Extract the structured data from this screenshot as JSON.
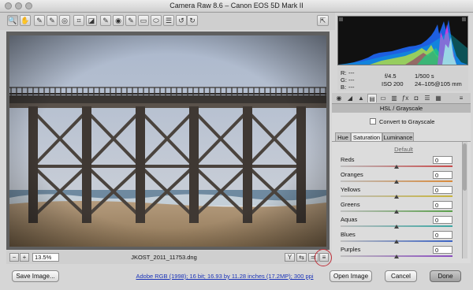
{
  "window": {
    "title": "Camera Raw 8.6  –  Canon EOS 5D Mark II"
  },
  "toolbar": {
    "tools": [
      {
        "name": "zoom-tool-icon",
        "glyph": "🔍"
      },
      {
        "name": "hand-tool-icon",
        "glyph": "✋"
      },
      {
        "name": "white-balance-tool-icon",
        "glyph": "✎"
      },
      {
        "name": "color-sampler-tool-icon",
        "glyph": "✎"
      },
      {
        "name": "target-adjustment-tool-icon",
        "glyph": "◎"
      },
      {
        "name": "crop-tool-icon",
        "glyph": "⌗"
      },
      {
        "name": "straighten-tool-icon",
        "glyph": "◪"
      },
      {
        "name": "spot-removal-tool-icon",
        "glyph": "✎"
      },
      {
        "name": "red-eye-tool-icon",
        "glyph": "◉"
      },
      {
        "name": "adjustment-brush-icon",
        "glyph": "✎"
      },
      {
        "name": "graduated-filter-icon",
        "glyph": "▭"
      },
      {
        "name": "radial-filter-icon",
        "glyph": "⬭"
      },
      {
        "name": "preferences-icon",
        "glyph": "☰"
      },
      {
        "name": "rotate-ccw-icon",
        "glyph": "↺"
      },
      {
        "name": "rotate-cw-icon",
        "glyph": "↻"
      }
    ],
    "fullscreen_icon": "⇱"
  },
  "statusbar": {
    "zoom": "13.5%",
    "filename": "JKOST_2011_11753.dng"
  },
  "info": {
    "r_label": "R:",
    "g_label": "G:",
    "b_label": "B:",
    "r": "---",
    "g": "---",
    "b": "---",
    "aperture": "f/4.5",
    "shutter": "1/500 s",
    "iso": "ISO 200",
    "lens": "24–105@105 mm"
  },
  "panel": {
    "title": "HSL / Grayscale",
    "convert_label": "Convert to Grayscale",
    "convert_checked": false,
    "subtabs": [
      "Hue",
      "Saturation",
      "Luminance"
    ],
    "active_subtab": "Saturation",
    "default_label": "Default",
    "sliders": [
      {
        "label": "Reds",
        "value": "0",
        "color": "#c84a4a"
      },
      {
        "label": "Oranges",
        "value": "0",
        "color": "#d98a3a"
      },
      {
        "label": "Yellows",
        "value": "0",
        "color": "#c9b43a"
      },
      {
        "label": "Greens",
        "value": "0",
        "color": "#5aa04a"
      },
      {
        "label": "Aquas",
        "value": "0",
        "color": "#3ba7a3"
      },
      {
        "label": "Blues",
        "value": "0",
        "color": "#3b63c4"
      },
      {
        "label": "Purples",
        "value": "0",
        "color": "#8a4cc0"
      }
    ]
  },
  "footer": {
    "save_label": "Save Image...",
    "workflow_link": "Adobe RGB (1998); 16 bit; 16.93 by 11.28 inches (17.2MP); 300 ppi",
    "open_label": "Open Image",
    "cancel_label": "Cancel",
    "done_label": "Done"
  },
  "colors": {
    "highlight_ring": "#c0303a",
    "link": "#1a33b8"
  }
}
